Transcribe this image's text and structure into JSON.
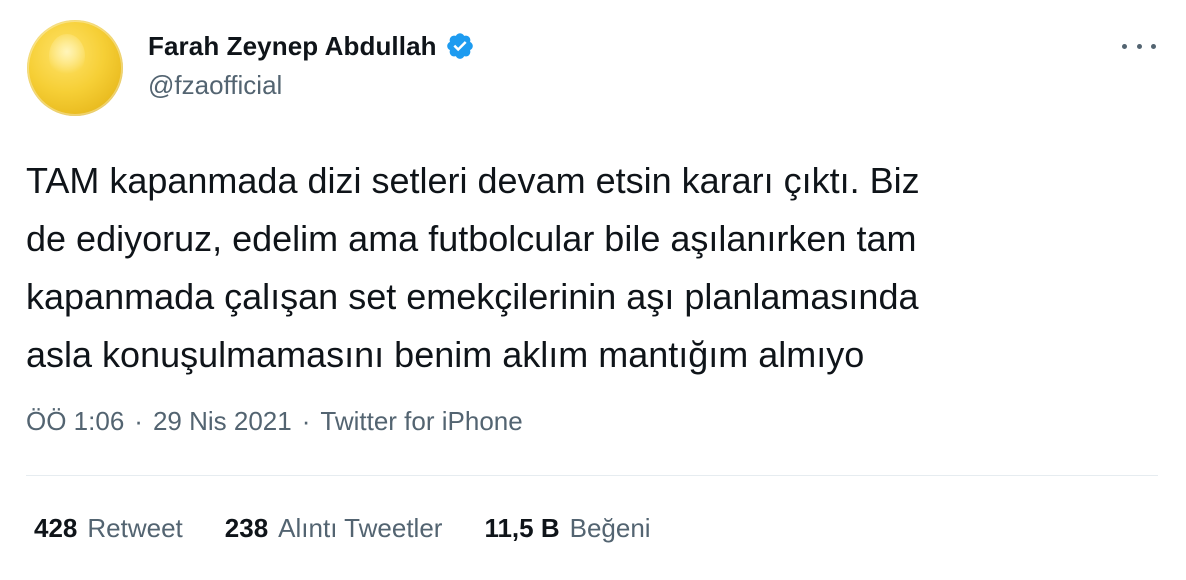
{
  "author": {
    "display_name": "Farah Zeynep Abdullah",
    "handle": "@fzaofficial",
    "verified": true,
    "avatar_icon": "yellow-balloon-avatar",
    "verified_color": "#1d9bf0"
  },
  "more_icon": "ellipsis-icon",
  "tweet": {
    "text": "TAM kapanmada dizi setleri devam etsin kararı çıktı. Biz\nde ediyoruz, edelim ama futbolcular bile aşılanırken tam\nkapanmada çalışan set emekçilerinin aşı planlamasında\nasla konuşulmamasını benim aklım mantığım almıyo"
  },
  "meta": {
    "time": "ÖÖ 1:06",
    "separator": "·",
    "date": "29 Nis 2021",
    "source": "Twitter for iPhone"
  },
  "stats": [
    {
      "count": "428",
      "label": "Retweet"
    },
    {
      "count": "238",
      "label": "Alıntı Tweetler"
    },
    {
      "count": "11,5 B",
      "label": "Beğeni"
    }
  ],
  "colors": {
    "text": "#0f1419",
    "secondary": "#536471",
    "divider": "#e6ecf0"
  }
}
